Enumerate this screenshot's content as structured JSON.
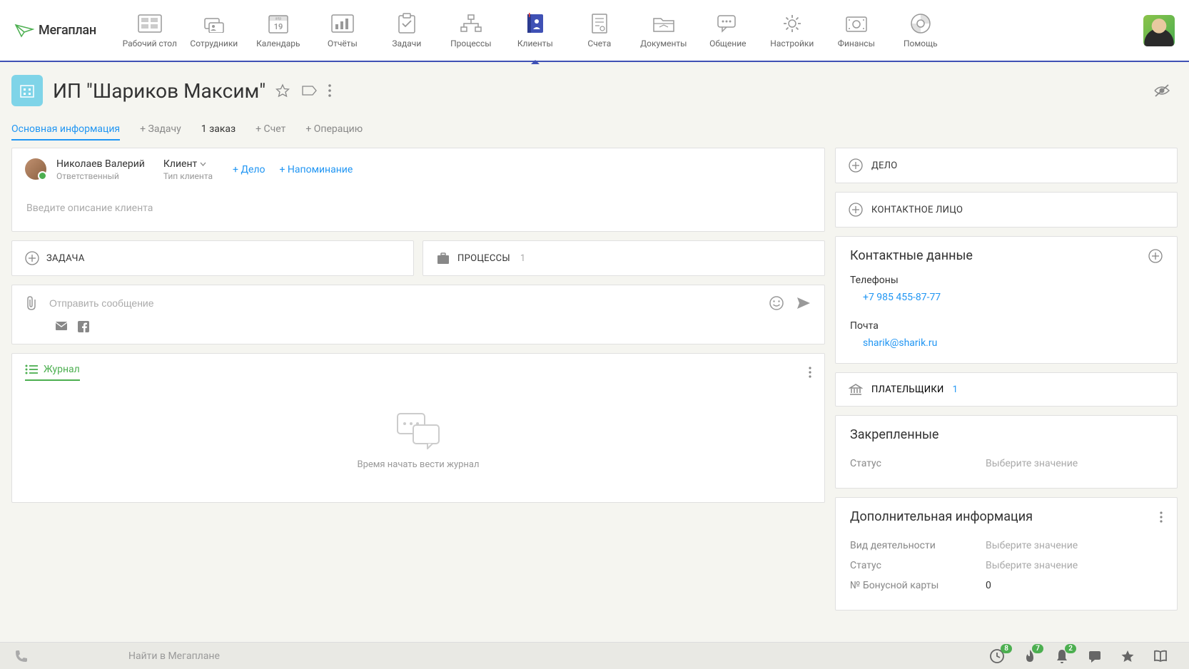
{
  "logo": "Мегаплан",
  "nav": [
    {
      "label": "Рабочий стол"
    },
    {
      "label": "Сотрудники"
    },
    {
      "label": "Календарь",
      "day": "19",
      "month": "апр"
    },
    {
      "label": "Отчёты"
    },
    {
      "label": "Задачи"
    },
    {
      "label": "Процессы"
    },
    {
      "label": "Клиенты"
    },
    {
      "label": "Счета"
    },
    {
      "label": "Документы"
    },
    {
      "label": "Общение"
    },
    {
      "label": "Настройки"
    },
    {
      "label": "Финансы"
    },
    {
      "label": "Помощь"
    }
  ],
  "page": {
    "title": "ИП \"Шариков Максим\""
  },
  "tabs": {
    "main": "Основная информация",
    "task": "+ Задачу",
    "order": "1 заказ",
    "invoice": "+ Счет",
    "operation": "+ Операцию"
  },
  "responsible": {
    "name": "Николаев Валерий",
    "role": "Ответственный",
    "clientTypeValue": "Клиент",
    "clientTypeLabel": "Тип клиента",
    "addDeal": "+ Дело",
    "addReminder": "+ Напоминание"
  },
  "description": {
    "placeholder": "Введите описание клиента"
  },
  "cards": {
    "task": "ЗАДАЧА",
    "process": "ПРОЦЕССЫ",
    "processCount": "1"
  },
  "message": {
    "placeholder": "Отправить сообщение"
  },
  "journal": {
    "tab": "Журнал",
    "empty": "Время начать вести журнал"
  },
  "side": {
    "deal": "ДЕЛО",
    "contactPerson": "КОНТАКТНОЕ ЛИЦО",
    "contactData": "Контактные данные",
    "phones": "Телефоны",
    "phone": "+7 985 455-87-77",
    "emails": "Почта",
    "email": "sharik@sharik.ru",
    "payers": "ПЛАТЕЛЬЩИКИ",
    "payersCount": "1",
    "pinned": "Закрепленные",
    "status": "Статус",
    "selectValue": "Выберите значение",
    "extraInfo": "Дополнительная информация",
    "activityType": "Вид деятельности",
    "bonusCard": "№ Бонусной карты",
    "bonusCardValue": "0"
  },
  "bottom": {
    "search": "Найти в Мегаплане",
    "badge1": "8",
    "badge2": "7",
    "badge3": "2"
  }
}
